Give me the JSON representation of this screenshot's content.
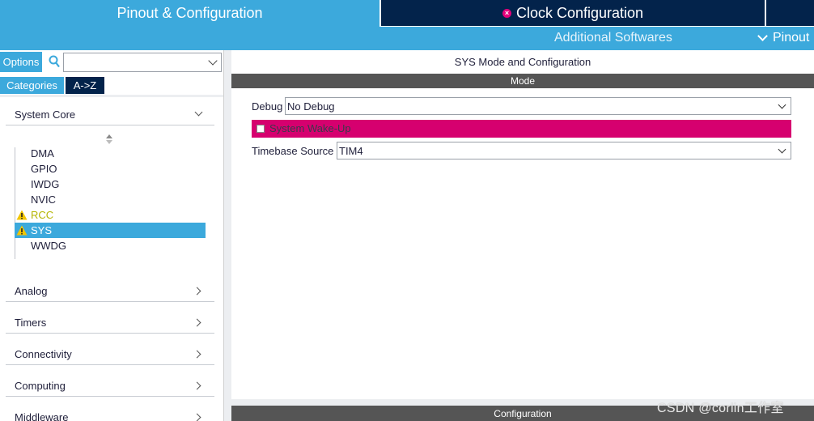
{
  "tabs": {
    "pinout_config": "Pinout & Configuration",
    "clock_config": "Clock Configuration"
  },
  "subbar": {
    "additional": "Additional Softwares",
    "pinout": "Pinout"
  },
  "left": {
    "options_label": "Options",
    "search_value": "",
    "categories_label": "Categories",
    "az_label": "A->Z",
    "categories": [
      {
        "label": "System Core",
        "expanded": true
      },
      {
        "label": "Analog",
        "expanded": false
      },
      {
        "label": "Timers",
        "expanded": false
      },
      {
        "label": "Connectivity",
        "expanded": false
      },
      {
        "label": "Computing",
        "expanded": false
      },
      {
        "label": "Middleware",
        "expanded": false
      }
    ],
    "system_core_items": [
      {
        "label": "DMA",
        "status": "normal"
      },
      {
        "label": "GPIO",
        "status": "normal"
      },
      {
        "label": "IWDG",
        "status": "normal"
      },
      {
        "label": "NVIC",
        "status": "normal"
      },
      {
        "label": "RCC",
        "status": "warning"
      },
      {
        "label": "SYS",
        "status": "warning-selected"
      },
      {
        "label": "WWDG",
        "status": "normal"
      }
    ]
  },
  "right": {
    "title": "SYS Mode and Configuration",
    "mode_header": "Mode",
    "debug_label": "Debug",
    "debug_value": "No Debug",
    "wakeup_label": "System Wake-Up",
    "wakeup_checked": false,
    "timebase_label": "Timebase Source",
    "timebase_value": "TIM4",
    "config_header": "Configuration"
  },
  "watermark": "CSDN @corlin工作室",
  "colors": {
    "accent_blue": "#3ca9dc",
    "navy": "#03234b",
    "error_pink": "#d6006f",
    "warning_yellow": "#b4b400"
  }
}
